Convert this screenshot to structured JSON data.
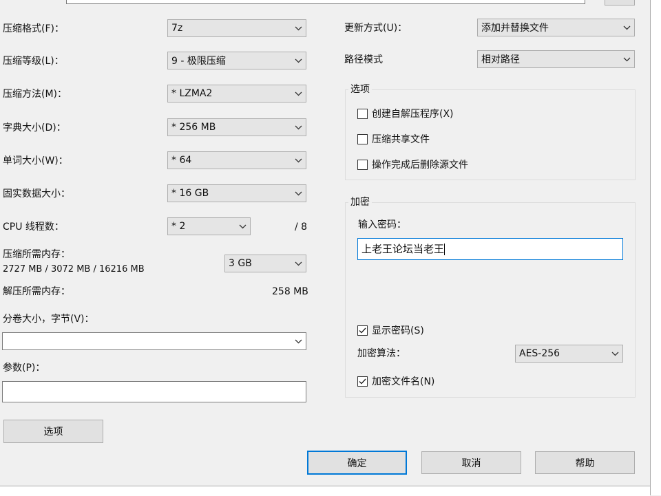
{
  "left": {
    "format": {
      "label": "压缩格式(F)：",
      "value": "7z"
    },
    "level": {
      "label": "压缩等级(L)：",
      "value": "9 - 极限压缩"
    },
    "method": {
      "label": "压缩方法(M)：",
      "value": "* LZMA2"
    },
    "dict": {
      "label": "字典大小(D)：",
      "value": "* 256 MB"
    },
    "word": {
      "label": "单词大小(W)：",
      "value": "* 64"
    },
    "solid": {
      "label": "固实数据大小：",
      "value": "* 16 GB"
    },
    "threads": {
      "label": "CPU 线程数：",
      "value": "* 2",
      "max": "/ 8"
    },
    "mem_compress": {
      "label": "压缩所需内存：",
      "detail": "2727 MB / 3072 MB / 16216 MB",
      "value": "3 GB"
    },
    "mem_decompress": {
      "label": "解压所需内存：",
      "value": "258 MB"
    },
    "volume": {
      "label": "分卷大小，字节(V)：",
      "value": ""
    },
    "params": {
      "label": "参数(P)：",
      "value": ""
    },
    "options_button": "选项"
  },
  "right": {
    "update": {
      "label": "更新方式(U)：",
      "value": "添加并替换文件"
    },
    "path": {
      "label": "路径模式",
      "value": "相对路径"
    },
    "options": {
      "title": "选项",
      "items": [
        {
          "label": "创建自解压程序(X)",
          "checked": false
        },
        {
          "label": "压缩共享文件",
          "checked": false
        },
        {
          "label": "操作完成后删除源文件",
          "checked": false
        }
      ]
    },
    "encryption": {
      "title": "加密",
      "password_label": "输入密码：",
      "password_value": "上老王论坛当老王",
      "show_password": {
        "label": "显示密码(S)",
        "checked": true
      },
      "method_label": "加密算法：",
      "method_value": "AES-256",
      "encrypt_names": {
        "label": "加密文件名(N)",
        "checked": true
      }
    }
  },
  "buttons": {
    "ok": "确定",
    "cancel": "取消",
    "help": "帮助"
  },
  "colors": {
    "accent": "#0078d7",
    "face": "#f0f0f0",
    "combo": "#e5e5e5"
  }
}
